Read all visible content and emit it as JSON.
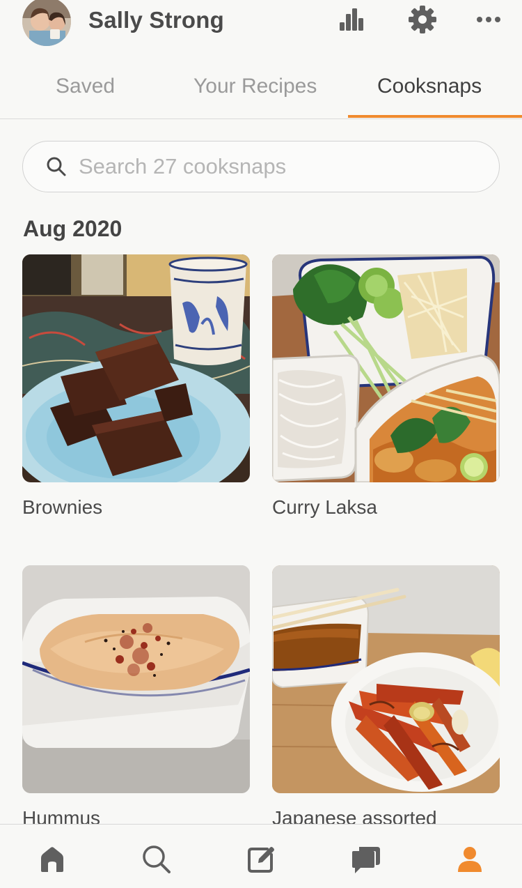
{
  "header": {
    "username": "Sally Strong",
    "icons": [
      "stats-icon",
      "gear-icon",
      "more-icon"
    ]
  },
  "tabs": [
    {
      "label": "Saved",
      "active": false
    },
    {
      "label": "Your Recipes",
      "active": false
    },
    {
      "label": "Cooksnaps",
      "active": true
    }
  ],
  "search": {
    "placeholder": "Search 27 cooksnaps",
    "value": ""
  },
  "section": {
    "title": "Aug 2020"
  },
  "cooksnaps": [
    {
      "title": "Brownies"
    },
    {
      "title": "Curry Laksa"
    },
    {
      "title": "Hummus"
    },
    {
      "title": "Japanese assorted"
    }
  ],
  "bottom_nav": {
    "items": [
      "home-icon",
      "search-icon",
      "compose-icon",
      "chat-icon",
      "profile-icon"
    ],
    "active": "profile-icon"
  },
  "colors": {
    "accent": "#f08a2e",
    "text": "#4a4a4a",
    "muted": "#9a9a9a",
    "icon": "#5f5f5f"
  }
}
